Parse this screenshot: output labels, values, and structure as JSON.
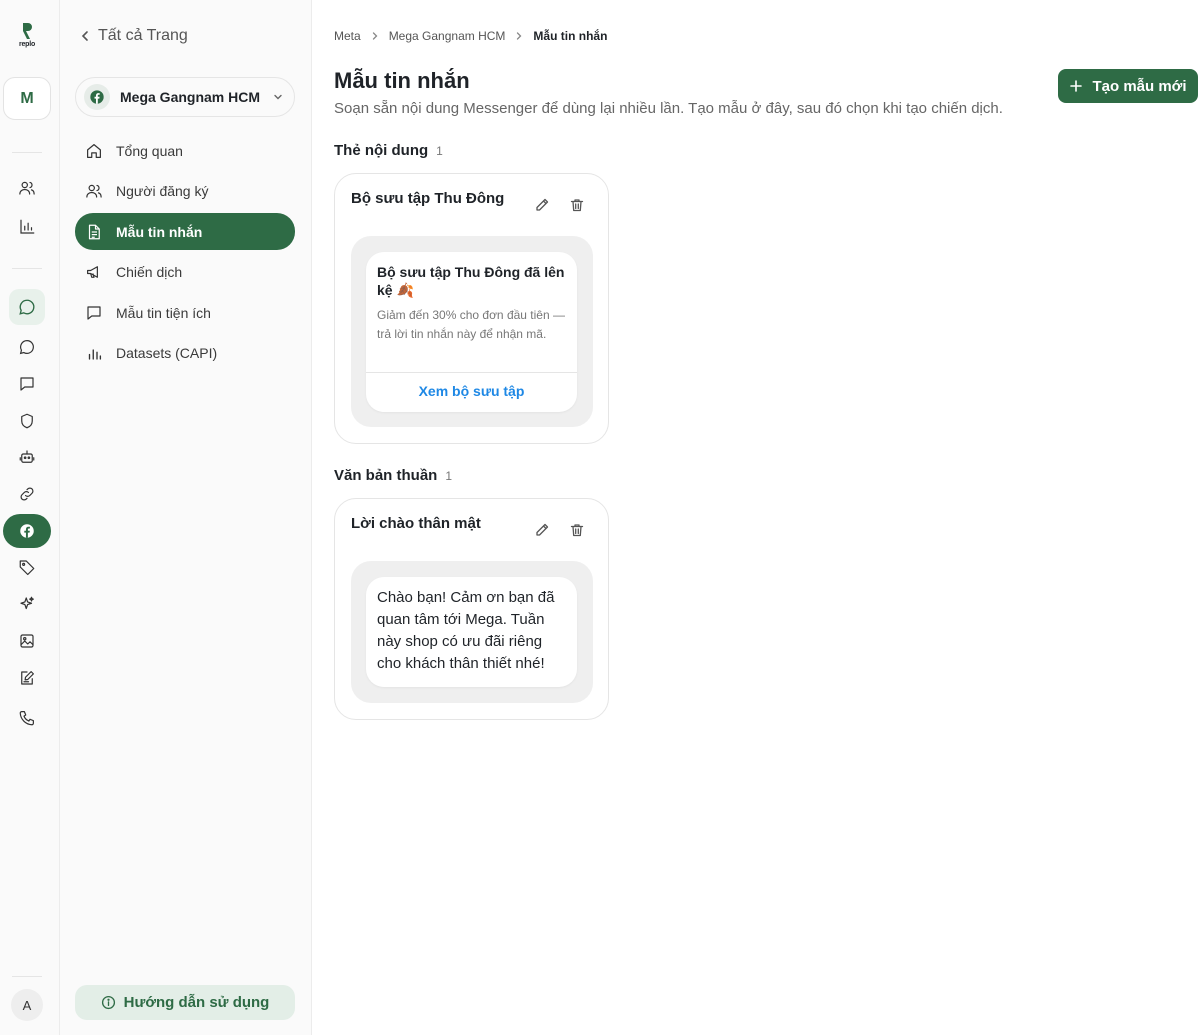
{
  "brand": {
    "logo_text": "replo"
  },
  "rail": {
    "workspace_initial": "M",
    "avatar_initial": "A"
  },
  "sidebar": {
    "back_label": "Tất cả Trang",
    "page_name": "Mega Gangnam HCM",
    "items": [
      {
        "label": "Tổng quan",
        "icon": "home-icon"
      },
      {
        "label": "Người đăng ký",
        "icon": "users-icon"
      },
      {
        "label": "Mẫu tin nhắn",
        "icon": "document-icon",
        "active": true
      },
      {
        "label": "Chiến dịch",
        "icon": "megaphone-icon"
      },
      {
        "label": "Mẫu tin tiện ích",
        "icon": "message-square-icon"
      },
      {
        "label": "Datasets (CAPI)",
        "icon": "bar-chart-icon"
      }
    ],
    "help_label": "Hướng dẫn sử dụng"
  },
  "breadcrumb": [
    "Meta",
    "Mega Gangnam HCM",
    "Mẫu tin nhắn"
  ],
  "page": {
    "title": "Mẫu tin nhắn",
    "subtitle": "Soạn sẵn nội dung Messenger để dùng lại nhiều lần. Tạo mẫu ở đây, sau đó chọn khi tạo chiến dịch.",
    "new_button": "Tạo mẫu mới"
  },
  "sections": {
    "card": {
      "title": "Thẻ nội dung",
      "count": "1",
      "template": {
        "name": "Bộ sưu tập Thu Đông",
        "preview_title": "Bộ sưu tập Thu Đông đã lên kệ 🍂",
        "preview_body": "Giảm đến 30% cho đơn đầu tiên — trả lời tin nhắn này để nhận mã.",
        "preview_button": "Xem bộ sưu tập"
      }
    },
    "text": {
      "title": "Văn bản thuần",
      "count": "1",
      "template": {
        "name": "Lời chào thân mật",
        "preview_text": "Chào bạn! Cảm ơn bạn đã quan tâm tới Mega. Tuần này shop có ưu đãi riêng cho khách thân thiết nhé!"
      }
    }
  },
  "colors": {
    "accent": "#2e6b45",
    "accent_soft": "#e3eee7",
    "link": "#1e88e5"
  }
}
